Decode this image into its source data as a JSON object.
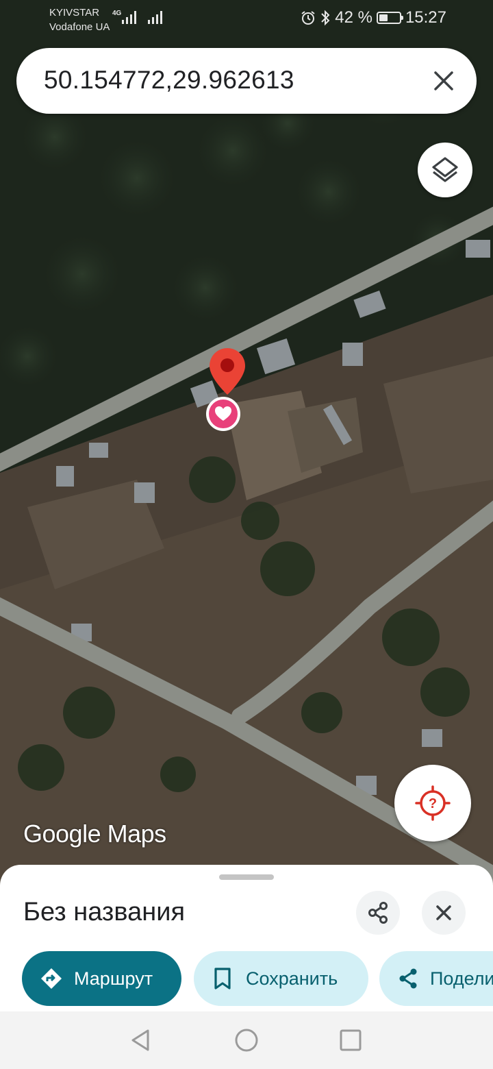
{
  "status_bar": {
    "carrier_1": "KYIVSTAR",
    "carrier_2": "Vodafone UA",
    "network_type": "4G",
    "battery_level": 0.42,
    "battery_text": "42 %",
    "time": "15:27",
    "icons": [
      "signal-icon",
      "alarm-icon",
      "bluetooth-icon",
      "battery-icon"
    ]
  },
  "search": {
    "query": "50.154772,29.962613",
    "clear_icon": "close-icon"
  },
  "map": {
    "type": "satellite",
    "logo": "Google Maps",
    "layers_icon": "layers-icon",
    "locate_icon": "my-location-icon",
    "pin_icon": "map-pin-icon",
    "favorite_icon": "heart-icon",
    "colors": {
      "pin": "#ea4335",
      "favorite": "#e8407a"
    }
  },
  "place_sheet": {
    "title": "Без названия",
    "share_icon": "share-icon",
    "close_icon": "close-icon",
    "actions": [
      {
        "label": "Маршрут",
        "icon": "directions-icon",
        "style": "primary"
      },
      {
        "label": "Сохранить",
        "icon": "bookmark-icon",
        "style": "secondary"
      },
      {
        "label": "Поделиться",
        "icon": "share-icon",
        "style": "secondary"
      }
    ],
    "colors": {
      "primary": "#0b7285",
      "secondary_bg": "#d3f0f6",
      "secondary_text": "#08606e"
    }
  },
  "nav_bar": {
    "buttons": [
      "back-icon",
      "home-icon",
      "recents-icon"
    ]
  }
}
